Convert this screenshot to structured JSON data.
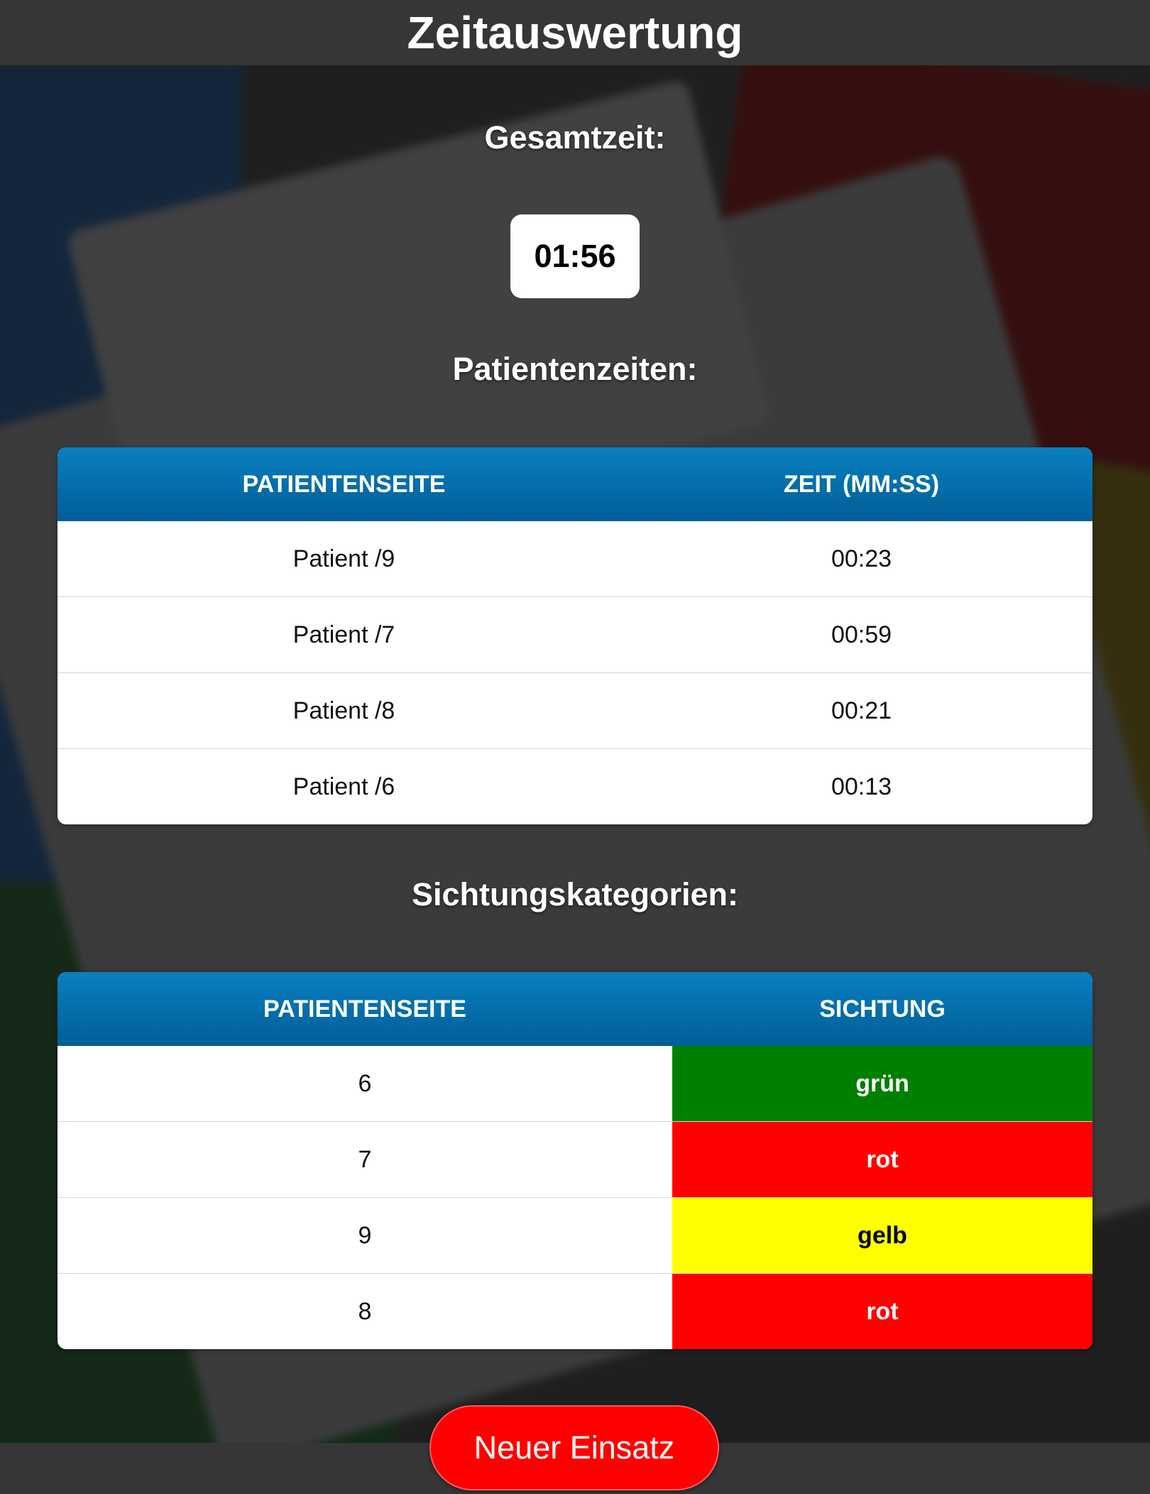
{
  "header": {
    "title": "Zeitauswertung"
  },
  "total": {
    "label": "Gesamtzeit:",
    "value": "01:56"
  },
  "patient_times": {
    "title": "Patientenzeiten:",
    "columns": [
      "PATIENTENSEITE",
      "ZEIT (MM:SS)"
    ],
    "rows": [
      {
        "patient": "Patient /9",
        "time": "00:23"
      },
      {
        "patient": "Patient /7",
        "time": "00:59"
      },
      {
        "patient": "Patient /8",
        "time": "00:21"
      },
      {
        "patient": "Patient /6",
        "time": "00:13"
      }
    ]
  },
  "triage": {
    "title": "Sichtungskategorien:",
    "columns": [
      "PATIENTENSEITE",
      "SICHTUNG"
    ],
    "rows": [
      {
        "page": "6",
        "category": "grün",
        "color": "#008000",
        "text_color": "#ffffff"
      },
      {
        "page": "7",
        "category": "rot",
        "color": "#ff0000",
        "text_color": "#ffffff"
      },
      {
        "page": "9",
        "category": "gelb",
        "color": "#ffff00",
        "text_color": "#000000"
      },
      {
        "page": "8",
        "category": "rot",
        "color": "#ff0000",
        "text_color": "#ffffff"
      }
    ]
  },
  "actions": {
    "new_mission": "Neuer Einsatz"
  }
}
